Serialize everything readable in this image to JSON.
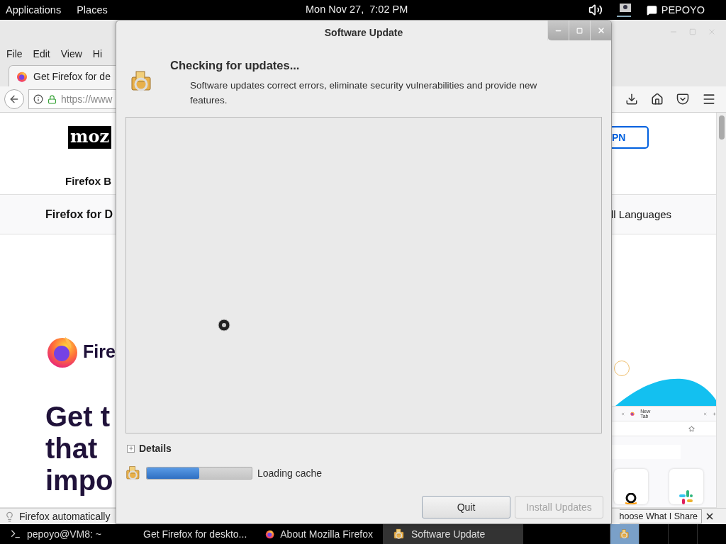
{
  "top_bar": {
    "menus": [
      "Applications",
      "Places"
    ],
    "clock": "Mon Nov 27,  7:02 PM",
    "user": "PEPOYO"
  },
  "browser": {
    "menus": [
      "File",
      "Edit",
      "View",
      "Hi"
    ],
    "tab": {
      "title": "Get Firefox for de"
    },
    "url": "https://www",
    "page": {
      "logo": "moz",
      "nav_link": "Firefox B",
      "subnav_link": "Firefox for D",
      "languages_link": "ll Languages",
      "vpn_button": "PN",
      "brand": "Fire",
      "headline": [
        "Get t",
        "that",
        "impo"
      ],
      "mock_tab": "New Tab"
    },
    "notification": {
      "message": "Firefox automatically",
      "button": "hoose What I Share"
    }
  },
  "dialog": {
    "title": "Software Update",
    "heading": "Checking for updates...",
    "description": "Software updates correct errors, eliminate security vulnerabilities and provide new features.",
    "details": {
      "label": "Details",
      "expanded": false
    },
    "progress": {
      "level": 0.5,
      "status": "Loading cache"
    },
    "buttons": [
      {
        "label": "Quit",
        "disabled": false
      },
      {
        "label": "Install Updates",
        "disabled": true
      }
    ]
  },
  "taskbar": [
    {
      "label": "pepoyo@VM8: ~",
      "kind": "terminal",
      "selected": false
    },
    {
      "label": "Get Firefox for deskto...",
      "kind": "browser",
      "selected": false
    },
    {
      "label": "About Mozilla Firefox",
      "kind": "browser",
      "selected": false
    },
    {
      "label": "Software Update",
      "kind": "updater",
      "selected": true
    }
  ]
}
